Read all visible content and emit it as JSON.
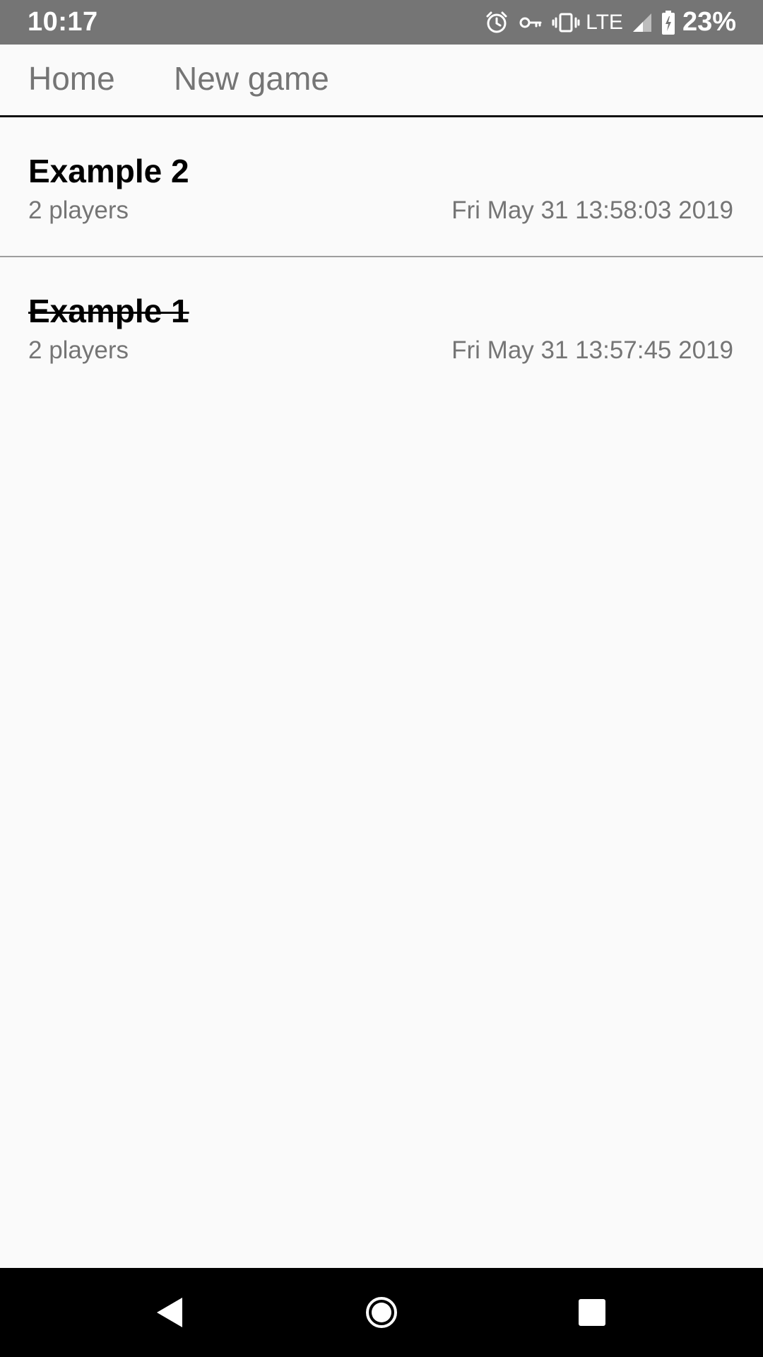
{
  "status_bar": {
    "time": "10:17",
    "network": "LTE",
    "battery": "23%",
    "icons": [
      "alarm-icon",
      "key-icon",
      "vibrate-icon",
      "signal-icon",
      "battery-charging-icon"
    ]
  },
  "tabs": [
    {
      "label": "Home"
    },
    {
      "label": "New game"
    }
  ],
  "games": [
    {
      "name": "Example 2",
      "players": "2 players",
      "date": "Fri May 31 13:58:03 2019",
      "struck": false
    },
    {
      "name": "Example 1",
      "players": "2 players",
      "date": "Fri May 31 13:57:45 2019",
      "struck": true
    }
  ],
  "nav_bar": {
    "icons": [
      "back-icon",
      "home-icon",
      "recents-icon"
    ]
  },
  "colors": {
    "status_bar_bg": "#757575",
    "background": "#fafafa",
    "secondary_text": "#757575",
    "nav_bar_bg": "#000000"
  }
}
